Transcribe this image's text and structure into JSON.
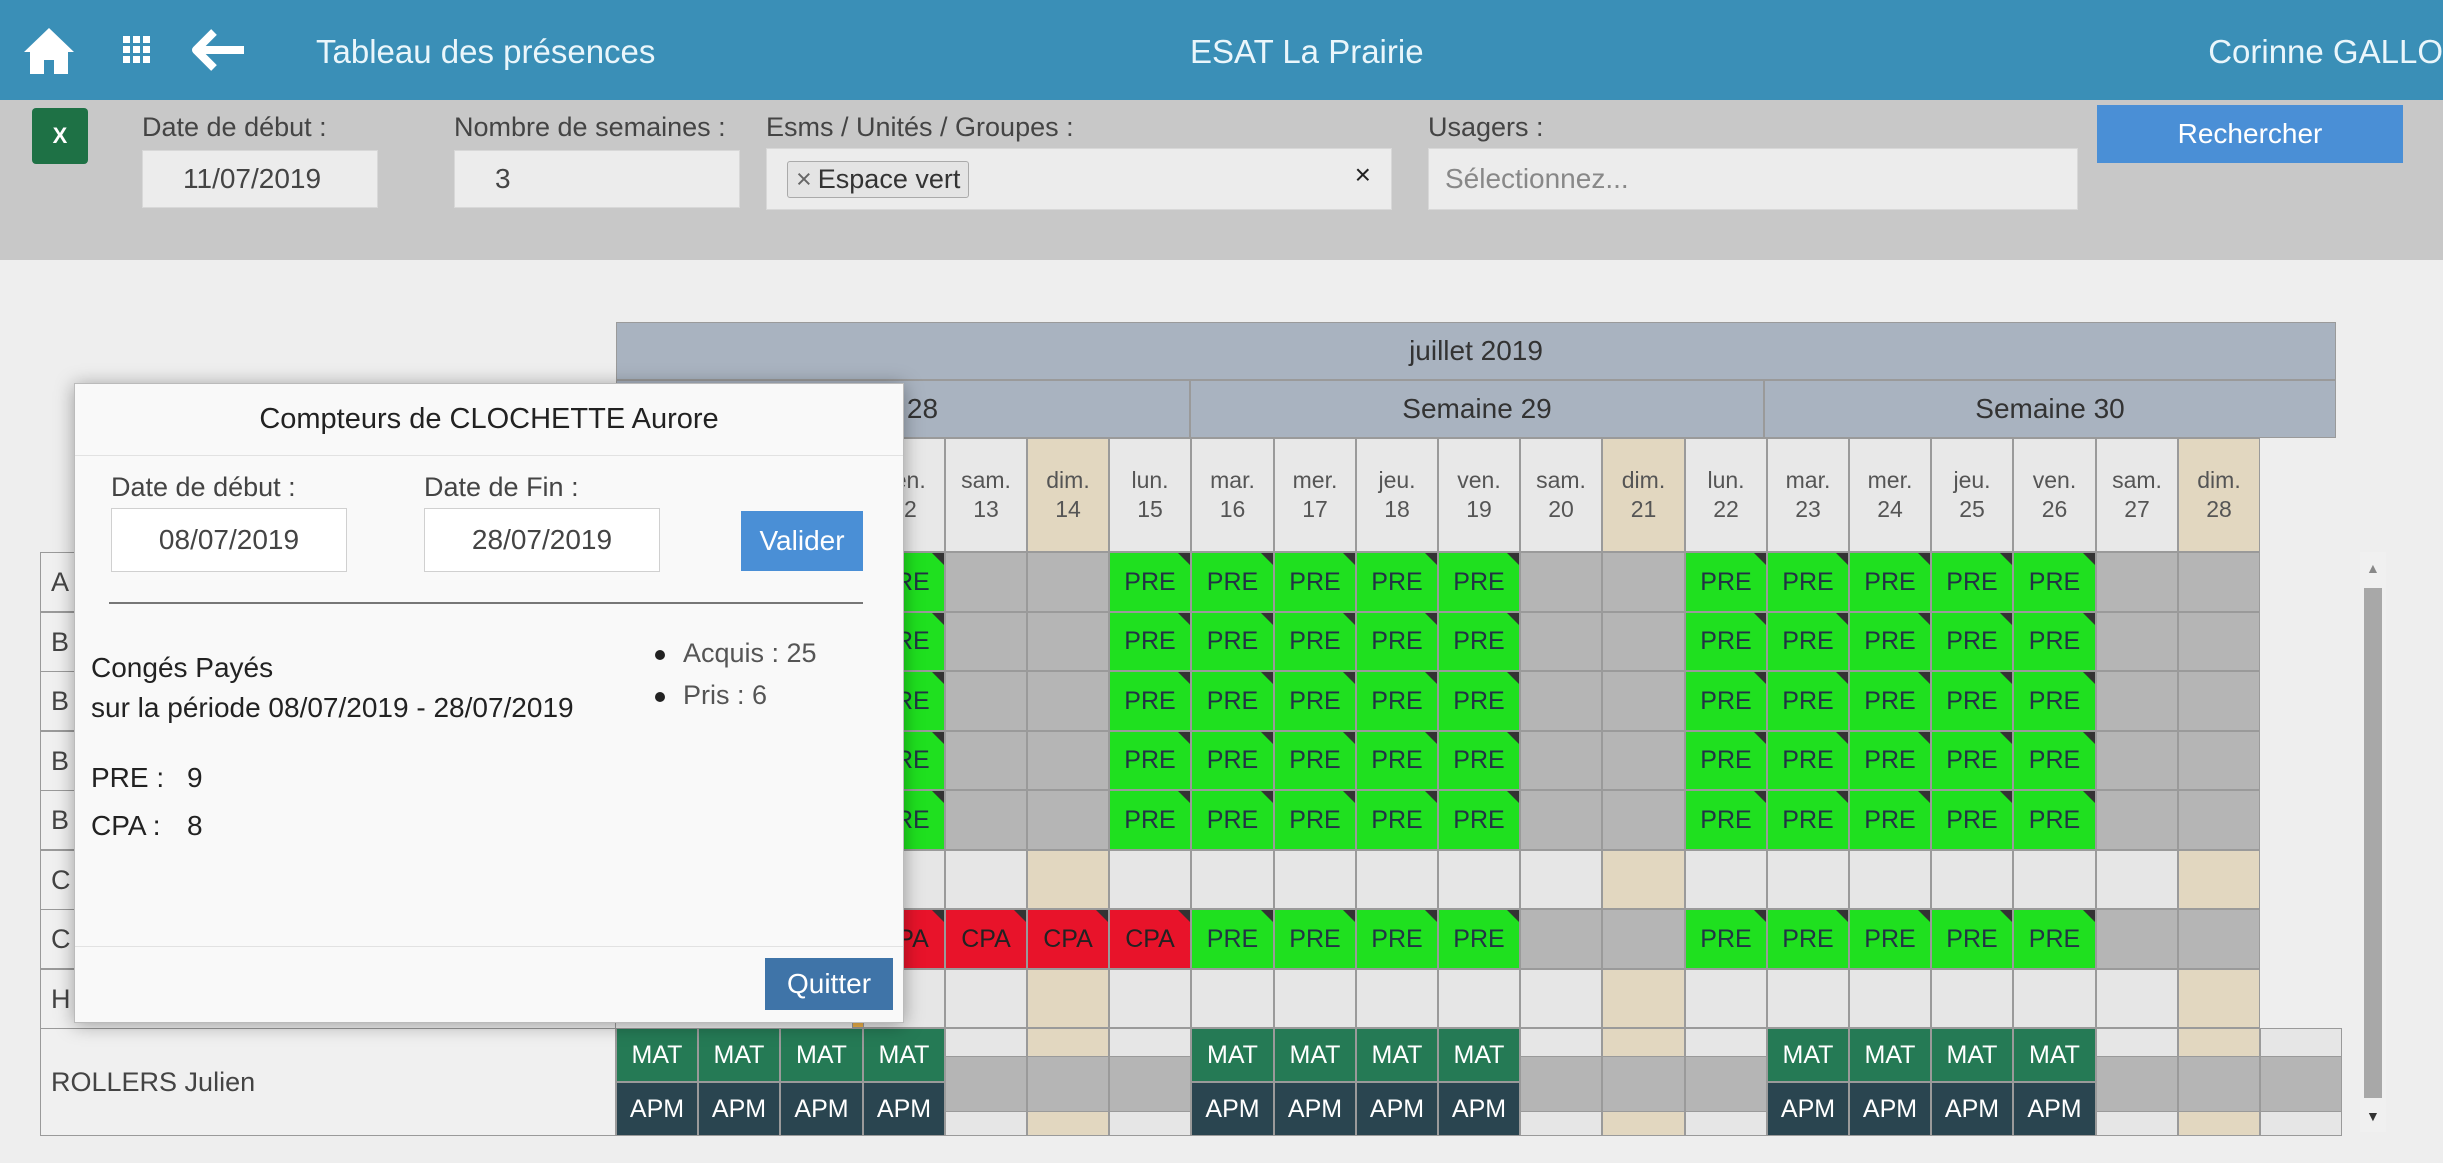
{
  "header": {
    "home_icon": "home-icon",
    "apps_icon": "grid-icon",
    "back_icon": "arrow-left-icon",
    "page_title": "Tableau des présences",
    "org_name": "ESAT La Prairie",
    "user_name": "Corinne GALLO"
  },
  "filters": {
    "excel_label": "X",
    "start_date_label": "Date de début :",
    "start_date_value": "11/07/2019",
    "weeks_label": "Nombre de semaines :",
    "weeks_value": "3",
    "esms_label": "Esms / Unités / Groupes :",
    "esms_tag": "Espace vert",
    "esms_tag_remove": "×",
    "esms_clear": "×",
    "users_label": "Usagers :",
    "users_placeholder": "Sélectionnez...",
    "search_button": "Rechercher"
  },
  "calendar": {
    "month": "juillet 2019",
    "weeks": [
      "Semaine 28",
      "Semaine 29",
      "Semaine 30"
    ],
    "week28_partial": "ne 28",
    "days": [
      {
        "d": "ven.",
        "n": "12"
      },
      {
        "d": "sam.",
        "n": "13"
      },
      {
        "d": "dim.",
        "n": "14"
      },
      {
        "d": "lun.",
        "n": "15"
      },
      {
        "d": "mar.",
        "n": "16"
      },
      {
        "d": "mer.",
        "n": "17"
      },
      {
        "d": "jeu.",
        "n": "18"
      },
      {
        "d": "ven.",
        "n": "19"
      },
      {
        "d": "sam.",
        "n": "20"
      },
      {
        "d": "dim.",
        "n": "21"
      },
      {
        "d": "lun.",
        "n": "22"
      },
      {
        "d": "mar.",
        "n": "23"
      },
      {
        "d": "mer.",
        "n": "24"
      },
      {
        "d": "jeu.",
        "n": "25"
      },
      {
        "d": "ven.",
        "n": "26"
      },
      {
        "d": "sam.",
        "n": "27"
      },
      {
        "d": "dim.",
        "n": "28"
      }
    ],
    "partial_day_header": {
      "d": "l.",
      "n": "1"
    },
    "row_initials": [
      "A",
      "B",
      "B",
      "B",
      "B",
      "C",
      "C",
      "H"
    ],
    "rows": [
      {
        "lead": [
          "A"
        ],
        "cells": [
          "PRE",
          "",
          "",
          "PRE",
          "PRE",
          "PRE",
          "PRE",
          "PRE",
          "",
          "",
          "PRE",
          "PRE",
          "PRE",
          "PRE",
          "PRE",
          "",
          ""
        ]
      },
      {
        "lead": [
          "E"
        ],
        "cells": [
          "PRE",
          "",
          "",
          "PRE",
          "PRE",
          "PRE",
          "PRE",
          "PRE",
          "",
          "",
          "PRE",
          "PRE",
          "PRE",
          "PRE",
          "PRE",
          "",
          ""
        ]
      },
      {
        "lead": [
          "E"
        ],
        "cells": [
          "PRE",
          "",
          "",
          "PRE",
          "PRE",
          "PRE",
          "PRE",
          "PRE",
          "",
          "",
          "PRE",
          "PRE",
          "PRE",
          "PRE",
          "PRE",
          "",
          ""
        ]
      },
      {
        "lead": [
          "E"
        ],
        "cells": [
          "PRE",
          "",
          "",
          "PRE",
          "PRE",
          "PRE",
          "PRE",
          "PRE",
          "",
          "",
          "PRE",
          "PRE",
          "PRE",
          "PRE",
          "PRE",
          "",
          ""
        ]
      },
      {
        "lead": [
          "E"
        ],
        "cells": [
          "PRE",
          "",
          "",
          "PRE",
          "PRE",
          "PRE",
          "PRE",
          "PRE",
          "",
          "",
          "PRE",
          "PRE",
          "PRE",
          "PRE",
          "PRE",
          "",
          ""
        ]
      },
      {
        "lead": [
          ""
        ],
        "cells": [
          "",
          "",
          "",
          "",
          "",
          "",
          "",
          "",
          "",
          "",
          "",
          "",
          "",
          "",
          "",
          "",
          ""
        ]
      },
      {
        "lead": [
          "A"
        ],
        "cells": [
          "CPA",
          "CPA",
          "CPA",
          "CPA",
          "PRE",
          "PRE",
          "PRE",
          "PRE",
          "",
          "",
          "PRE",
          "PRE",
          "PRE",
          "PRE",
          "PRE",
          "",
          ""
        ]
      },
      {
        "lead": [
          ""
        ],
        "cells": [
          "",
          "",
          "",
          "",
          "",
          "",
          "",
          "",
          "",
          "",
          "",
          "",
          "",
          "",
          "",
          "",
          ""
        ]
      }
    ],
    "last_row_name": "ROLLERS Julien",
    "last_row_top": [
      "MAT",
      "MAT",
      "MAT",
      "MAT",
      "",
      "",
      "",
      "MAT",
      "MAT",
      "MAT",
      "MAT",
      "",
      "",
      "",
      "MAT",
      "MAT",
      "MAT",
      "MAT",
      "",
      "",
      ""
    ],
    "last_row_mid": "MAT",
    "last_row_bottom": [
      "APM",
      "APM",
      "APM",
      "APM",
      "",
      "",
      "",
      "APM",
      "APM",
      "APM",
      "APM",
      "",
      "",
      "",
      "APM",
      "APM",
      "APM",
      "APM",
      "",
      "",
      ""
    ]
  },
  "modal": {
    "title": "Compteurs de CLOCHETTE Aurore",
    "start_label": "Date de début :",
    "start_value": "08/07/2019",
    "end_label": "Date de Fin :",
    "end_value": "28/07/2019",
    "validate_button": "Valider",
    "leave_title": "Congés Payés",
    "leave_period": "sur la période 08/07/2019 - 28/07/2019",
    "acquired": "Acquis : 25",
    "taken": "Pris : 6",
    "pre_label": "PRE :",
    "pre_value": "9",
    "cpa_label": "CPA :",
    "cpa_value": "8",
    "quit_button": "Quitter"
  }
}
